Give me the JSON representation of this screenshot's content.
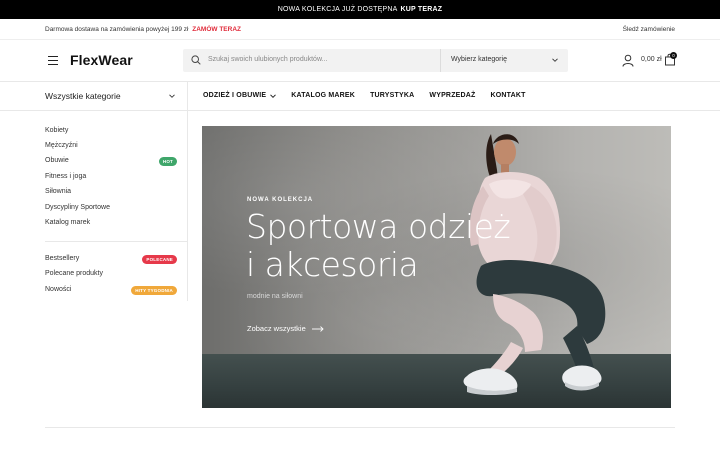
{
  "promo": {
    "text": "NOWA KOLEKCJA JUŻ DOSTĘPNA",
    "cta": "KUP TERAZ"
  },
  "infobar": {
    "shipping": "Darmowa dostawa na zamówienia powyżej 199 zł",
    "order_now": "ZAMÓW TERAZ",
    "track": "Śledź zamówienie"
  },
  "header": {
    "logo": "FlexWear",
    "search_placeholder": "Szukaj swoich ulubionych produktów...",
    "category_select": "Wybierz kategorię",
    "cart_total": "0,00 zł",
    "cart_count": "0"
  },
  "nav": {
    "all_categories": "Wszystkie kategorie",
    "items": [
      {
        "label": "ODZIEŻ I OBUWIE",
        "has_dropdown": true
      },
      {
        "label": "KATALOG MAREK"
      },
      {
        "label": "TURYSTYKA"
      },
      {
        "label": "WYPRZEDAŻ"
      },
      {
        "label": "KONTAKT"
      }
    ]
  },
  "sidebar": {
    "categories": [
      {
        "label": "Kobiety"
      },
      {
        "label": "Mężczyźni"
      },
      {
        "label": "Obuwie",
        "tag": "HOT",
        "tag_color": "#3fa66a"
      },
      {
        "label": "Fitness i joga"
      },
      {
        "label": "Siłownia"
      },
      {
        "label": "Dyscypliny Sportowe"
      },
      {
        "label": "Katalog marek"
      }
    ],
    "featured": [
      {
        "label": "Bestsellery",
        "tag": "POLECANE",
        "tag_color": "#e6394a"
      },
      {
        "label": "Polecane produkty"
      },
      {
        "label": "Nowości",
        "tag": "HITY TYGODNIA",
        "tag_color": "#f0a83a"
      }
    ]
  },
  "hero": {
    "kicker": "NOWA KOLEKCJA",
    "title_line1": "Sportowa odzież",
    "title_line2": "i akcesoria",
    "subtitle": "modnie na siłowni",
    "cta": "Zobacz wszystkie"
  },
  "colors": {
    "accent_red": "#e02b3a",
    "topbar_bg": "#000000"
  }
}
